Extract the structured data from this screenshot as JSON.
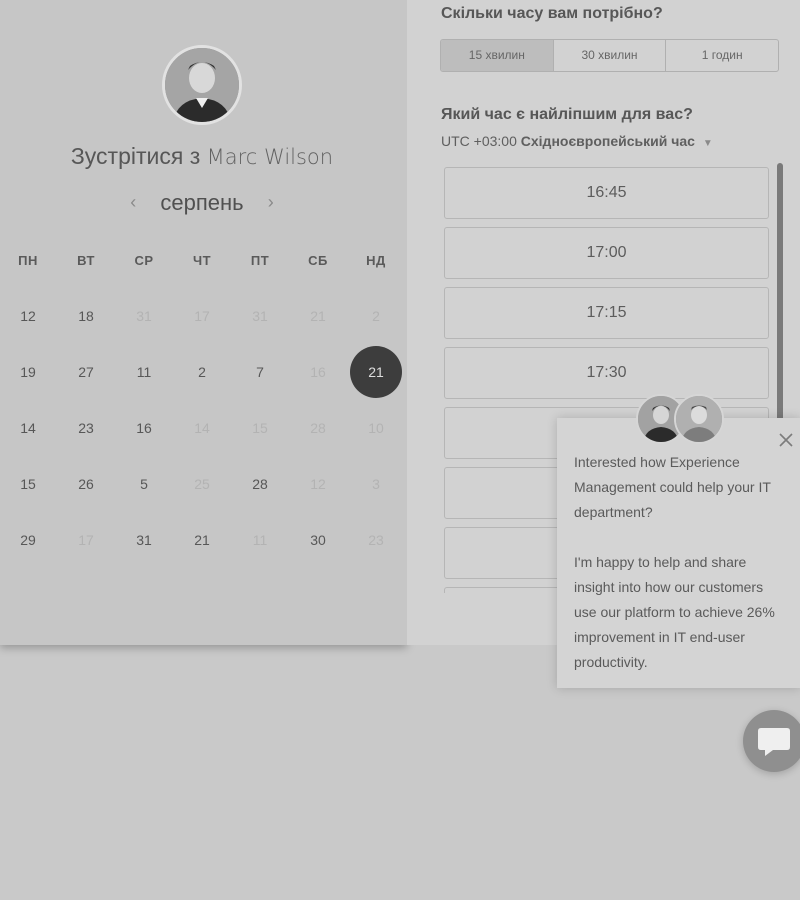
{
  "calendar": {
    "host_prefix": "Зустрітися з",
    "host_name": "Marc Wilson",
    "month": "серпень",
    "weekdays": [
      "ПН",
      "ВТ",
      "СР",
      "ЧТ",
      "ПТ",
      "СБ",
      "НД"
    ],
    "weeks": [
      [
        "12",
        "18",
        "31",
        "17",
        "31",
        "21",
        "2"
      ],
      [
        "19",
        "27",
        "11",
        "2",
        "7",
        "16",
        "21"
      ],
      [
        "14",
        "23",
        "16",
        "14",
        "15",
        "28",
        "10"
      ],
      [
        "15",
        "26",
        "5",
        "25",
        "28",
        "12",
        "3"
      ],
      [
        "29",
        "17",
        "31",
        "21",
        "11",
        "30",
        "23"
      ]
    ],
    "muted": [
      [
        false,
        false,
        true,
        true,
        true,
        true,
        true
      ],
      [
        false,
        false,
        false,
        false,
        false,
        true,
        false
      ],
      [
        false,
        false,
        false,
        true,
        true,
        true,
        true
      ],
      [
        false,
        false,
        false,
        true,
        false,
        true,
        true
      ],
      [
        false,
        true,
        false,
        false,
        true,
        false,
        true
      ]
    ],
    "selected_day": "21"
  },
  "duration": {
    "heading": "Скільки часу вам потрібно?",
    "options": [
      "15 хвилин",
      "30 хвилин",
      "1 годин"
    ],
    "active": "15 хвилин"
  },
  "timeslots": {
    "heading": "Який час є найліпшим для вас?",
    "timezone_offset": "UTC +03:00",
    "timezone_name": "Східноєвропейський час",
    "slots": [
      "16:45",
      "17:00",
      "17:15",
      "17:30"
    ],
    "empty_slot_count": 4
  },
  "chat": {
    "message_1": "Interested how Experience Management could help your IT department?",
    "message_2": "I'm happy to help and share insight into how our customers use our platform to achieve 26% improvement in IT end-user productivity."
  },
  "icons": {
    "prev": "chevron-left-icon",
    "next": "chevron-right-icon",
    "dropdown": "caret-down-icon",
    "close": "close-icon",
    "chat": "chat-bubble-icon"
  }
}
